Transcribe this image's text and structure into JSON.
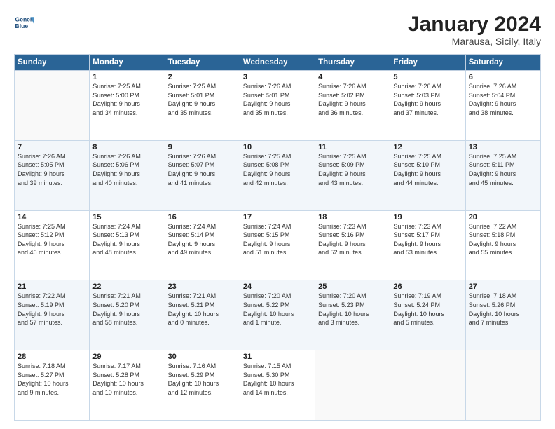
{
  "logo": {
    "line1": "General",
    "line2": "Blue"
  },
  "title": "January 2024",
  "subtitle": "Marausa, Sicily, Italy",
  "headers": [
    "Sunday",
    "Monday",
    "Tuesday",
    "Wednesday",
    "Thursday",
    "Friday",
    "Saturday"
  ],
  "weeks": [
    [
      {
        "day": "",
        "info": ""
      },
      {
        "day": "1",
        "info": "Sunrise: 7:25 AM\nSunset: 5:00 PM\nDaylight: 9 hours\nand 34 minutes."
      },
      {
        "day": "2",
        "info": "Sunrise: 7:25 AM\nSunset: 5:01 PM\nDaylight: 9 hours\nand 35 minutes."
      },
      {
        "day": "3",
        "info": "Sunrise: 7:26 AM\nSunset: 5:01 PM\nDaylight: 9 hours\nand 35 minutes."
      },
      {
        "day": "4",
        "info": "Sunrise: 7:26 AM\nSunset: 5:02 PM\nDaylight: 9 hours\nand 36 minutes."
      },
      {
        "day": "5",
        "info": "Sunrise: 7:26 AM\nSunset: 5:03 PM\nDaylight: 9 hours\nand 37 minutes."
      },
      {
        "day": "6",
        "info": "Sunrise: 7:26 AM\nSunset: 5:04 PM\nDaylight: 9 hours\nand 38 minutes."
      }
    ],
    [
      {
        "day": "7",
        "info": "Sunrise: 7:26 AM\nSunset: 5:05 PM\nDaylight: 9 hours\nand 39 minutes."
      },
      {
        "day": "8",
        "info": "Sunrise: 7:26 AM\nSunset: 5:06 PM\nDaylight: 9 hours\nand 40 minutes."
      },
      {
        "day": "9",
        "info": "Sunrise: 7:26 AM\nSunset: 5:07 PM\nDaylight: 9 hours\nand 41 minutes."
      },
      {
        "day": "10",
        "info": "Sunrise: 7:25 AM\nSunset: 5:08 PM\nDaylight: 9 hours\nand 42 minutes."
      },
      {
        "day": "11",
        "info": "Sunrise: 7:25 AM\nSunset: 5:09 PM\nDaylight: 9 hours\nand 43 minutes."
      },
      {
        "day": "12",
        "info": "Sunrise: 7:25 AM\nSunset: 5:10 PM\nDaylight: 9 hours\nand 44 minutes."
      },
      {
        "day": "13",
        "info": "Sunrise: 7:25 AM\nSunset: 5:11 PM\nDaylight: 9 hours\nand 45 minutes."
      }
    ],
    [
      {
        "day": "14",
        "info": "Sunrise: 7:25 AM\nSunset: 5:12 PM\nDaylight: 9 hours\nand 46 minutes."
      },
      {
        "day": "15",
        "info": "Sunrise: 7:24 AM\nSunset: 5:13 PM\nDaylight: 9 hours\nand 48 minutes."
      },
      {
        "day": "16",
        "info": "Sunrise: 7:24 AM\nSunset: 5:14 PM\nDaylight: 9 hours\nand 49 minutes."
      },
      {
        "day": "17",
        "info": "Sunrise: 7:24 AM\nSunset: 5:15 PM\nDaylight: 9 hours\nand 51 minutes."
      },
      {
        "day": "18",
        "info": "Sunrise: 7:23 AM\nSunset: 5:16 PM\nDaylight: 9 hours\nand 52 minutes."
      },
      {
        "day": "19",
        "info": "Sunrise: 7:23 AM\nSunset: 5:17 PM\nDaylight: 9 hours\nand 53 minutes."
      },
      {
        "day": "20",
        "info": "Sunrise: 7:22 AM\nSunset: 5:18 PM\nDaylight: 9 hours\nand 55 minutes."
      }
    ],
    [
      {
        "day": "21",
        "info": "Sunrise: 7:22 AM\nSunset: 5:19 PM\nDaylight: 9 hours\nand 57 minutes."
      },
      {
        "day": "22",
        "info": "Sunrise: 7:21 AM\nSunset: 5:20 PM\nDaylight: 9 hours\nand 58 minutes."
      },
      {
        "day": "23",
        "info": "Sunrise: 7:21 AM\nSunset: 5:21 PM\nDaylight: 10 hours\nand 0 minutes."
      },
      {
        "day": "24",
        "info": "Sunrise: 7:20 AM\nSunset: 5:22 PM\nDaylight: 10 hours\nand 1 minute."
      },
      {
        "day": "25",
        "info": "Sunrise: 7:20 AM\nSunset: 5:23 PM\nDaylight: 10 hours\nand 3 minutes."
      },
      {
        "day": "26",
        "info": "Sunrise: 7:19 AM\nSunset: 5:24 PM\nDaylight: 10 hours\nand 5 minutes."
      },
      {
        "day": "27",
        "info": "Sunrise: 7:18 AM\nSunset: 5:26 PM\nDaylight: 10 hours\nand 7 minutes."
      }
    ],
    [
      {
        "day": "28",
        "info": "Sunrise: 7:18 AM\nSunset: 5:27 PM\nDaylight: 10 hours\nand 9 minutes."
      },
      {
        "day": "29",
        "info": "Sunrise: 7:17 AM\nSunset: 5:28 PM\nDaylight: 10 hours\nand 10 minutes."
      },
      {
        "day": "30",
        "info": "Sunrise: 7:16 AM\nSunset: 5:29 PM\nDaylight: 10 hours\nand 12 minutes."
      },
      {
        "day": "31",
        "info": "Sunrise: 7:15 AM\nSunset: 5:30 PM\nDaylight: 10 hours\nand 14 minutes."
      },
      {
        "day": "",
        "info": ""
      },
      {
        "day": "",
        "info": ""
      },
      {
        "day": "",
        "info": ""
      }
    ]
  ]
}
